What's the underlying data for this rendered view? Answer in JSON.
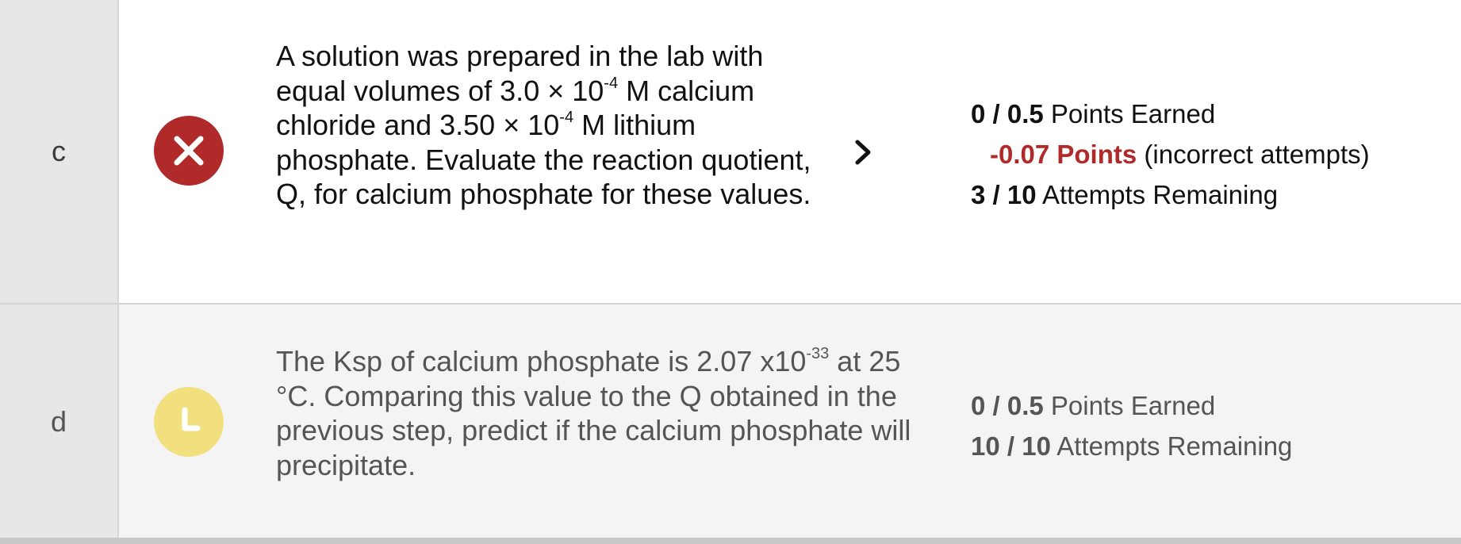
{
  "rows": [
    {
      "letter": "c",
      "status_icon": "incorrect-x-icon",
      "status_color": "#b02a2a",
      "question": {
        "p1": "A solution was prepared in the lab with equal volumes of  3.0 × 10",
        "sup1": "-4",
        "p2": " M calcium chloride and 3.50 × 10",
        "sup2": "-4",
        "p3": " M lithium phosphate.  Evaluate the reaction quotient, Q, for calcium phosphate for these values."
      },
      "expand_icon": "chevron-right-icon",
      "points_earned": "0 / 0.5",
      "points_earned_label": "Points Earned",
      "penalty_value": "-0.07 Points",
      "penalty_label": "(incorrect attempts)",
      "attempts": "3 / 10",
      "attempts_label": "Attempts Remaining"
    },
    {
      "letter": "d",
      "status_icon": "clock-pending-icon",
      "status_color": "#f2e07e",
      "question": {
        "p1": "The Ksp of calcium phosphate is 2.07 x10",
        "sup1": "-33",
        "p2": " at 25 °C. Comparing this value to the Q obtained in the previous step, predict if the calcium phosphate will precipitate."
      },
      "points_earned": "0 / 0.5",
      "points_earned_label": "Points Earned",
      "attempts": "10 / 10",
      "attempts_label": "Attempts Remaining"
    }
  ]
}
